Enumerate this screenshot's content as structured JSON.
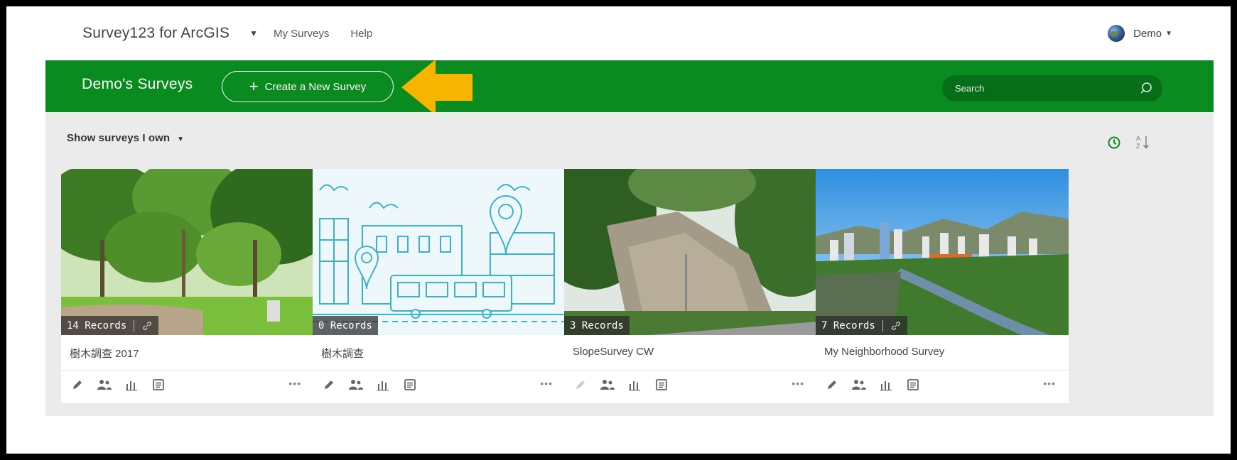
{
  "nav": {
    "brand": "Survey123 for ArcGIS",
    "links": [
      "My Surveys",
      "Help"
    ],
    "user": "Demo"
  },
  "banner": {
    "title": "Demo's Surveys",
    "create_label": "Create a New Survey",
    "search_placeholder": "Search"
  },
  "toolbar": {
    "filter_label": "Show surveys I own"
  },
  "colors": {
    "brand_green": "#098b1f",
    "search_green": "#066e18",
    "arrow": "#f7b500"
  },
  "cards": [
    {
      "records": "14 Records",
      "title": "樹木調查 2017",
      "shared": true,
      "edit_enabled": true
    },
    {
      "records": "0 Records",
      "title": "樹木調查",
      "shared": false,
      "edit_enabled": true
    },
    {
      "records": "3 Records",
      "title": "SlopeSurvey CW",
      "shared": false,
      "edit_enabled": false
    },
    {
      "records": "7 Records",
      "title": "My Neighborhood Survey",
      "shared": true,
      "edit_enabled": true
    }
  ]
}
